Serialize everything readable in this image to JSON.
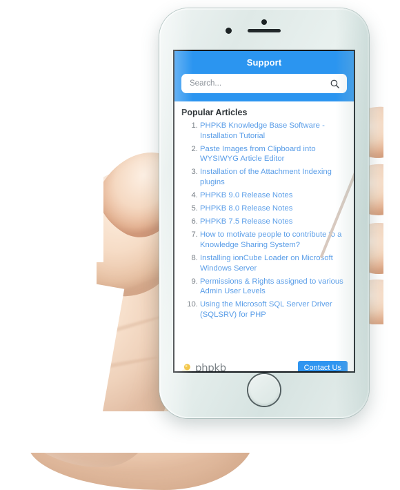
{
  "device": {
    "name": "smartphone-mockup",
    "speaker": "earpiece-speaker",
    "camera": "front-camera",
    "sensor": "proximity-sensor",
    "home": "home-button"
  },
  "colors": {
    "header_blue": "#2b95f0",
    "button_blue": "#2f95f0",
    "link_blue": "#5b9ee8",
    "marker_gray": "#7b8289",
    "heading_dark": "#2e3438",
    "screen_white": "#ffffff",
    "scrollbar_gray": "#d4d8db",
    "logo_gold": "#f2c23e"
  },
  "header": {
    "title": "Support"
  },
  "search": {
    "placeholder": "Search...",
    "value": "",
    "icon": "search-icon"
  },
  "main": {
    "section_title": "Popular Articles",
    "articles": [
      {
        "number": "1.",
        "title": "PHPKB Knowledge Base Software - Installation Tutorial"
      },
      {
        "number": "2.",
        "title": "Paste Images from Clipboard into WYSIWYG Article Editor"
      },
      {
        "number": "3.",
        "title": "Installation of the Attachment Indexing plugins"
      },
      {
        "number": "4.",
        "title": "PHPKB 9.0 Release Notes"
      },
      {
        "number": "5.",
        "title": "PHPKB 8.0 Release Notes"
      },
      {
        "number": "6.",
        "title": "PHPKB 7.5 Release Notes"
      },
      {
        "number": "7.",
        "title": "How to motivate people to contribute to a Knowledge Sharing System?"
      },
      {
        "number": "8.",
        "title": "Installing ionCube Loader on Microsoft Windows Server"
      },
      {
        "number": "9.",
        "title": "Permissions & Rights assigned to various Admin User Levels"
      },
      {
        "number": "10.",
        "title": "Using the Microsoft SQL Server Driver (SQLSRV) for PHP"
      }
    ]
  },
  "footer": {
    "brand_name": "phpkb",
    "brand_icon": "phpkb-logo-icon",
    "contact_label": "Contact Us"
  }
}
